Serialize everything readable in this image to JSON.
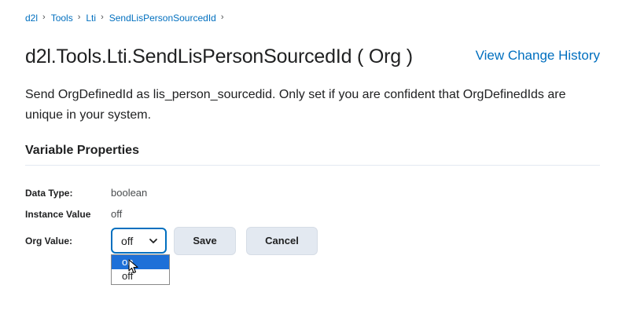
{
  "breadcrumb": {
    "items": [
      "d2l",
      "Tools",
      "Lti",
      "SendLisPersonSourcedId"
    ],
    "separator": "›"
  },
  "header": {
    "title": "d2l.Tools.Lti.SendLisPersonSourcedId ( Org )",
    "history_link": "View Change History"
  },
  "description": "Send OrgDefinedId as lis_person_sourcedid. Only set if you are confident that OrgDefinedIds are unique in your system.",
  "properties": {
    "heading": "Variable Properties",
    "data_type_label": "Data Type:",
    "data_type_value": "boolean",
    "instance_value_label": "Instance Value",
    "instance_value_value": "off",
    "org_value_label": "Org Value:"
  },
  "org_value_select": {
    "selected": "off",
    "options": [
      "on",
      "off"
    ],
    "highlighted_option": "on"
  },
  "buttons": {
    "save": "Save",
    "cancel": "Cancel"
  },
  "icons": {
    "select_chevron": "chevron-down-icon",
    "cursor": "pointer-cursor-icon"
  },
  "colors": {
    "link": "#006fbf",
    "focus_border": "#006fbf",
    "button_bg": "#e3e9f1",
    "option_highlight": "#1e70d8"
  }
}
